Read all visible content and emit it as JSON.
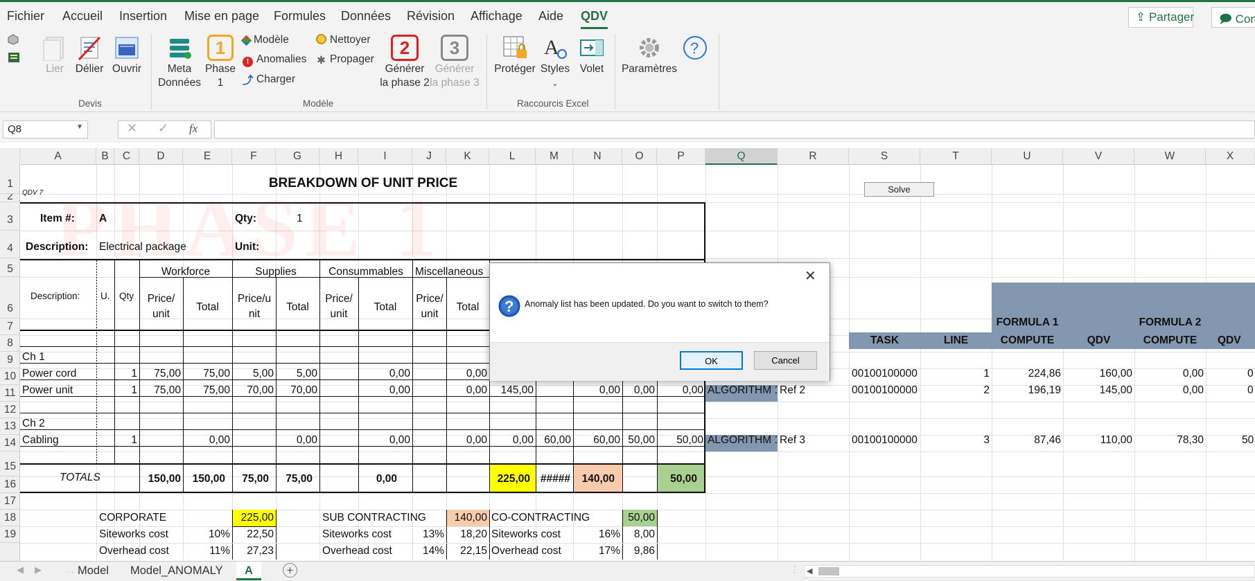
{
  "menu": {
    "tabs": [
      "Fichier",
      "Accueil",
      "Insertion",
      "Mise en page",
      "Formules",
      "Données",
      "Révision",
      "Affichage",
      "Aide",
      "QDV"
    ],
    "active_tab": "QDV",
    "share_label": "Partager",
    "comments_label": "Com"
  },
  "ribbon": {
    "devis": {
      "lier": "Lier",
      "delier": "Délier",
      "ouvrir": "Ouvrir",
      "group": "Devis"
    },
    "modele": {
      "meta_line1": "Meta",
      "meta_line2": "Données",
      "phase1_number": "1",
      "phase1_line1": "Phase",
      "phase1_line2": "1",
      "modele": "Modèle",
      "anomalies": "Anomalies",
      "charger": "Charger",
      "nettoyer": "Nettoyer",
      "propager": "Propager",
      "gen2_number": "2",
      "gen2_line1": "Générer",
      "gen2_line2": "la phase 2",
      "gen3_number": "3",
      "gen3_line1": "Générer",
      "gen3_line2": "la phase 3",
      "group": "Modèle"
    },
    "raccourcis": {
      "proteger": "Protéger",
      "styles": "Styles",
      "volet": "Volet",
      "group": "Raccourcis Excel"
    },
    "parametres": "Paramètres"
  },
  "formula_bar": {
    "name_box": "Q8",
    "fx": "fx",
    "value": ""
  },
  "columns": [
    "A",
    "B",
    "C",
    "D",
    "E",
    "F",
    "G",
    "H",
    "I",
    "J",
    "K",
    "L",
    "M",
    "N",
    "O",
    "P",
    "Q",
    "R",
    "S",
    "T",
    "U",
    "V",
    "W",
    "X"
  ],
  "selected_column": "Q",
  "rows": [
    "1",
    "2",
    "3",
    "4",
    "5",
    "6",
    "7",
    "8",
    "9",
    "10",
    "11",
    "12",
    "13",
    "14",
    "15",
    "16",
    "17",
    "18",
    "19"
  ],
  "sheet": {
    "title": "BREAKDOWN OF UNIT PRICE",
    "qdv_tag": "QDV 7",
    "watermark": "PHASE 1",
    "solve_button": "Solve",
    "item_label": "Item #:",
    "item_value": "A",
    "qty_label": "Qty:",
    "qty_value": "1",
    "desc_label": "Description:",
    "desc_value": "Electrical package",
    "unit_label": "Unit:",
    "hdr_description": "Description:",
    "hdr_u": "U.",
    "hdr_qty": "Qty",
    "hdr_workforce": "Workforce",
    "hdr_supplies": "Supplies",
    "hdr_consumables": "Consummables",
    "hdr_misc": "Miscellaneous",
    "hdr_price_unit": "Price/ unit",
    "hdr_price_u_nit": "Price/u nit",
    "hdr_total": "Total",
    "formula1": "FORMULA 1",
    "formula2": "FORMULA 2",
    "hdr_task": "TASK",
    "hdr_line": "LINE",
    "hdr_compute": "COMPUTE",
    "hdr_qdv": "QDV",
    "ch1": "Ch 1",
    "ch2": "Ch 2",
    "lines": [
      {
        "desc": "Power cord",
        "qty": "1",
        "d": "75,00",
        "e": "75,00",
        "f": "5,00",
        "g": "5,00",
        "i": "0,00",
        "k": "0,00",
        "l": "",
        "n": "",
        "o": "",
        "p": "",
        "algo": "",
        "ref": "",
        "task": "00100100000",
        "line": "1",
        "u": "224,86",
        "v": "160,00",
        "w": "0,00",
        "x": "0"
      },
      {
        "desc": "Power unit",
        "qty": "1",
        "d": "75,00",
        "e": "75,00",
        "f": "70,00",
        "g": "70,00",
        "i": "0,00",
        "k": "0,00",
        "l": "145,00",
        "n": "0,00",
        "o": "0,00",
        "p": "0,00",
        "algo": "ALGORITHM 1",
        "ref": "Ref 2",
        "task": "00100100000",
        "line": "2",
        "u": "196,19",
        "v": "145,00",
        "w": "0,00",
        "x": "0"
      },
      {
        "desc": "Cabling",
        "qty": "1",
        "d": "",
        "e": "0,00",
        "f": "",
        "g": "0,00",
        "i": "0,00",
        "k": "0,00",
        "l": "0,00",
        "m": "60,00",
        "n": "60,00",
        "o": "50,00",
        "p": "50,00",
        "algo": "ALGORITHM 1",
        "ref": "Ref 3",
        "task": "00100100000",
        "line": "3",
        "u": "87,46",
        "v": "110,00",
        "w": "78,30",
        "x": "50"
      }
    ],
    "totals": {
      "label": "TOTALS",
      "d": "150,00",
      "e": "150,00",
      "f": "75,00",
      "g": "75,00",
      "i": "0,00",
      "l": "225,00",
      "m": "#####",
      "n": "140,00",
      "p": "50,00"
    },
    "summary": {
      "corporate": "CORPORATE",
      "corporate_val": "225,00",
      "sub": "SUB CONTRACTING",
      "sub_val": "140,00",
      "co": "CO-CONTRACTING",
      "co_val": "50,00",
      "siteworks": "Siteworks cost",
      "overhead": "Overhead cost",
      "corp_site_pct": "10%",
      "corp_site_val": "22,50",
      "corp_over_pct": "11%",
      "corp_over_val": "27,23",
      "sub_site_pct": "13%",
      "sub_site_val": "18,20",
      "sub_over_pct": "14%",
      "sub_over_val": "22,15",
      "co_site_pct": "16%",
      "co_site_val": "8,00",
      "co_over_pct": "17%",
      "co_over_val": "9,86"
    }
  },
  "sheet_tabs": [
    "Model",
    "Model_ANOMALY",
    "A"
  ],
  "active_sheet": "A",
  "dialog": {
    "message": "Anomaly list has been updated. Do you want to switch to them?",
    "ok": "OK",
    "cancel": "Cancel"
  },
  "colors": {
    "excel_green": "#217346",
    "yellow": "#ffff00",
    "salmon": "#f8cbad",
    "green_fill": "#a9d08e",
    "slate": "#8497b0"
  }
}
